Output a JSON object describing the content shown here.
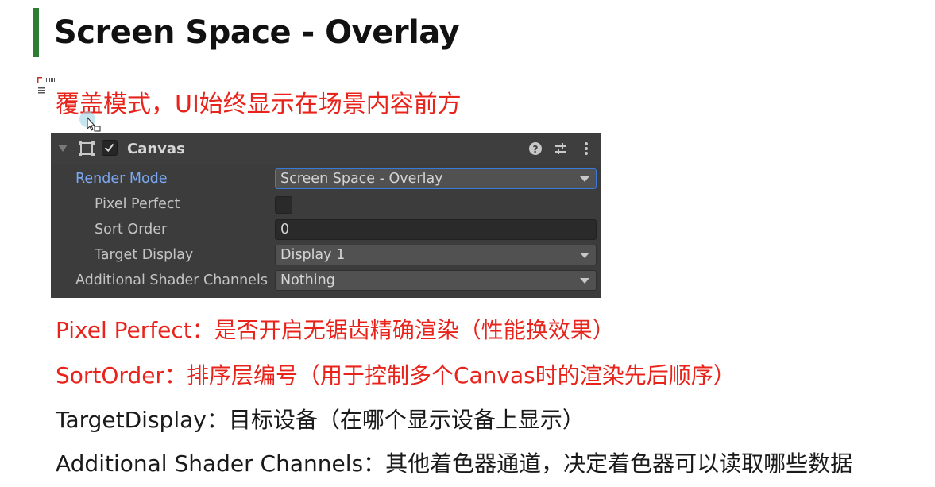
{
  "slide": {
    "title": "Screen Space - Overlay",
    "subtitle": "覆盖模式，UI始终显示在场景内容前方",
    "accent_color": "#2e7d32",
    "highlight_color": "#e8231b"
  },
  "inspector": {
    "component_name": "Canvas",
    "enabled": true,
    "header_icons": [
      "help-icon",
      "presets-icon",
      "more-menu-icon"
    ],
    "fields": {
      "render_mode": {
        "label": "Render Mode",
        "value": "Screen Space - Overlay"
      },
      "pixel_perfect": {
        "label": "Pixel Perfect",
        "checked": false
      },
      "sort_order": {
        "label": "Sort Order",
        "value": "0"
      },
      "target_display": {
        "label": "Target Display",
        "value": "Display 1"
      },
      "additional_shader_channels": {
        "label": "Additional Shader Channels",
        "value": "Nothing"
      }
    }
  },
  "notes": [
    {
      "text": "Pixel Perfect：是否开启无锯齿精确渲染（性能换效果）",
      "color": "red"
    },
    {
      "text": "SortOrder：排序层编号（用于控制多个Canvas时的渲染先后顺序）",
      "color": "red"
    },
    {
      "text": "TargetDisplay：目标设备（在哪个显示设备上显示）",
      "color": "black"
    },
    {
      "text": "Additional Shader Channels：其他着色器通道，决定着色器可以读取哪些数据",
      "color": "black"
    }
  ]
}
